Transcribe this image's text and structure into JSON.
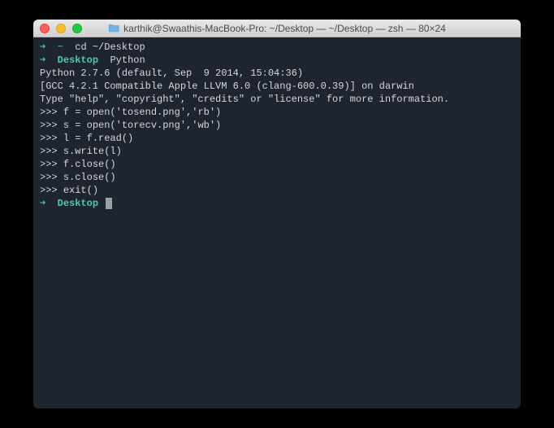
{
  "window": {
    "title": "karthik@Swaathis-MacBook-Pro: ~/Desktop — ~/Desktop — zsh — 80×24"
  },
  "lines": {
    "l0_arrow": "➜",
    "l0_tilde": "~",
    "l0_cmd": "cd ~/Desktop",
    "l1_arrow": "➜",
    "l1_dir": "Desktop",
    "l1_cmd": "Python",
    "l2": "Python 2.7.6 (default, Sep  9 2014, 15:04:36)",
    "l3": "[GCC 4.2.1 Compatible Apple LLVM 6.0 (clang-600.0.39)] on darwin",
    "l4": "Type \"help\", \"copyright\", \"credits\" or \"license\" for more information.",
    "l5_prompt": ">>> ",
    "l5_cmd": "f = open('tosend.png','rb')",
    "l6_prompt": ">>> ",
    "l6_cmd": "s = open('torecv.png','wb')",
    "l7_prompt": ">>> ",
    "l7_cmd": "l = f.read()",
    "l8_prompt": ">>> ",
    "l8_cmd": "s.write(l)",
    "l9_prompt": ">>> ",
    "l9_cmd": "f.close()",
    "l10_prompt": ">>> ",
    "l10_cmd": "s.close()",
    "l11_prompt": ">>> ",
    "l11_cmd": "exit()",
    "l12_arrow": "➜",
    "l12_dir": "Desktop"
  }
}
